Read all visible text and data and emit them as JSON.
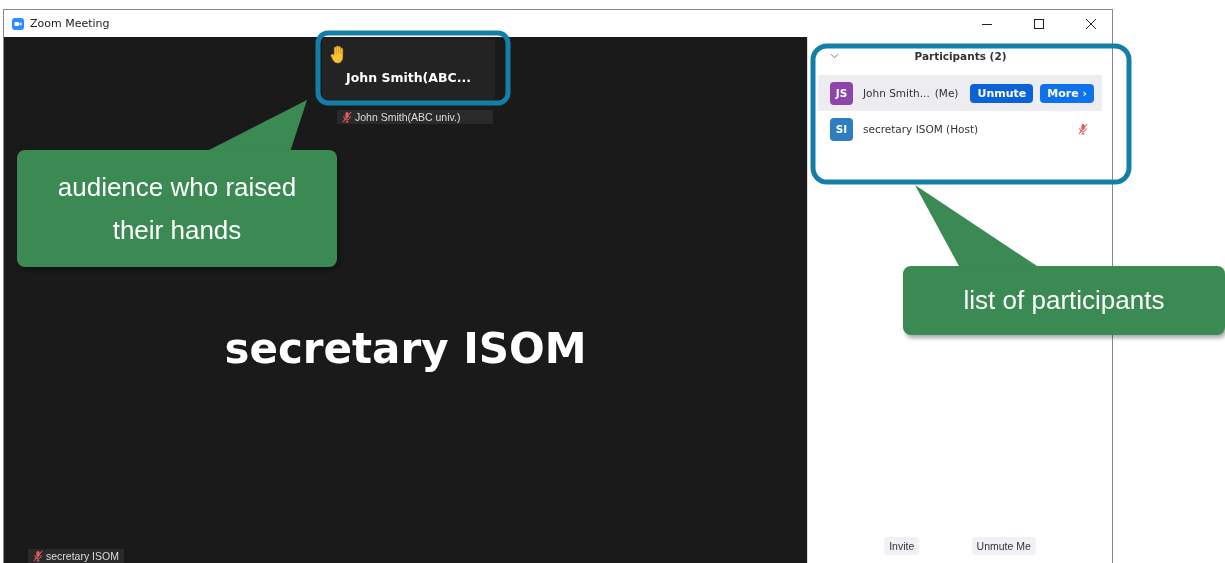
{
  "window": {
    "title": "Zoom Meeting"
  },
  "video": {
    "raised_hand_name": "John Smith(ABC...",
    "tile_name": "John Smith(ABC univ.)",
    "tile_muted": true,
    "speaker": "secretary ISOM",
    "speaker_label": "secretary ISOM",
    "speaker_muted": true
  },
  "participants": {
    "title": "Participants (2)",
    "expanded": true,
    "items": [
      {
        "initials": "JS",
        "color": "#8e44ad",
        "name": "John Smith...",
        "suffix": "(Me)",
        "highlighted": true,
        "buttons": [
          "Unmute",
          "More ›"
        ]
      },
      {
        "initials": "SI",
        "color": "#2d7ec0",
        "name": "secretary ISOM (Host)",
        "highlighted": false,
        "muted": true
      }
    ],
    "footer_buttons": [
      "Invite",
      "Unmute Me"
    ]
  },
  "callouts": [
    {
      "text": "audience who raised their hands"
    },
    {
      "text": "list of participants"
    }
  ]
}
